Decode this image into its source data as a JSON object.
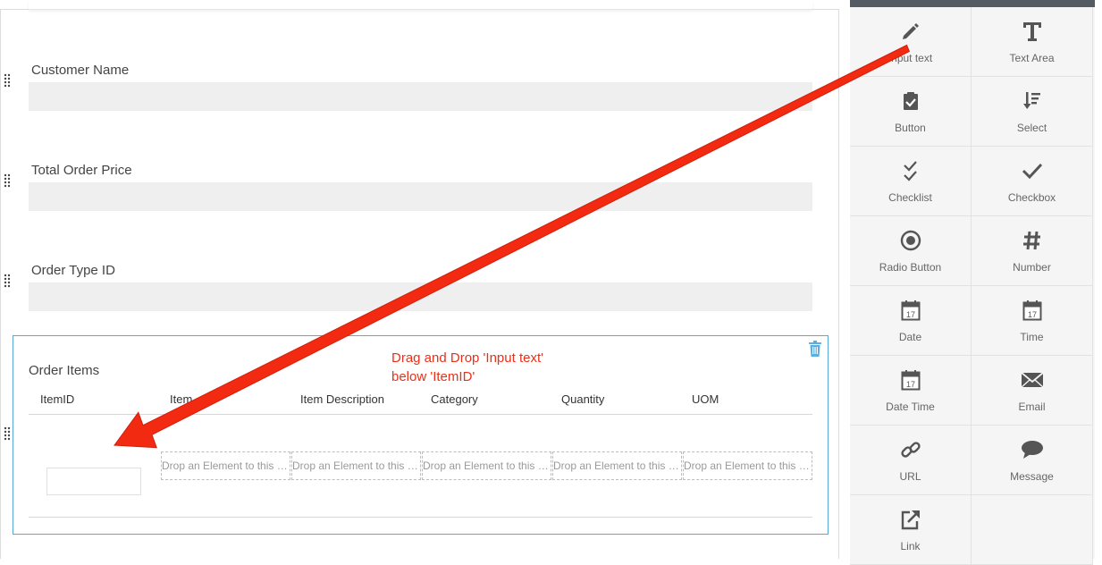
{
  "form": {
    "fields": [
      {
        "label": "Customer Name"
      },
      {
        "label": "Total Order Price"
      },
      {
        "label": "Order Type ID"
      }
    ],
    "table": {
      "title": "Order Items",
      "columns": [
        "ItemID",
        "Item",
        "Item Description",
        "Category",
        "Quantity",
        "UOM"
      ],
      "drop_placeholder": "Drop an Element to this …"
    }
  },
  "annotation": {
    "text": "Drag and Drop 'Input text' below 'ItemID'",
    "color": "#e8311b"
  },
  "palette": {
    "items": [
      {
        "label": "Input text",
        "icon": "pencil-icon"
      },
      {
        "label": "Text Area",
        "icon": "text-t-icon"
      },
      {
        "label": "Button",
        "icon": "clipboard-check-icon"
      },
      {
        "label": "Select",
        "icon": "sort-list-icon"
      },
      {
        "label": "Checklist",
        "icon": "double-check-icon"
      },
      {
        "label": "Checkbox",
        "icon": "check-icon"
      },
      {
        "label": "Radio Button",
        "icon": "radio-icon"
      },
      {
        "label": "Number",
        "icon": "hash-icon"
      },
      {
        "label": "Date",
        "icon": "calendar-icon"
      },
      {
        "label": "Time",
        "icon": "calendar-icon"
      },
      {
        "label": "Date Time",
        "icon": "calendar-icon"
      },
      {
        "label": "Email",
        "icon": "envelope-icon"
      },
      {
        "label": "URL",
        "icon": "link-chain-icon"
      },
      {
        "label": "Message",
        "icon": "speech-bubble-icon"
      },
      {
        "label": "Link",
        "icon": "external-link-icon"
      }
    ],
    "calendar_day": "17"
  },
  "colors": {
    "accent_border": "#59a9d8",
    "trash_icon": "#5aaee0",
    "palette_header": "#555b62"
  }
}
